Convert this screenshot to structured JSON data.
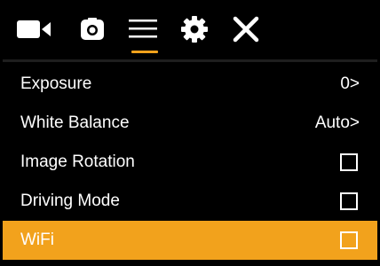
{
  "toolbar": {
    "icons": [
      {
        "name": "video-camera-icon"
      },
      {
        "name": "photo-camera-icon"
      },
      {
        "name": "menu-icon",
        "active": true
      },
      {
        "name": "gear-icon"
      },
      {
        "name": "close-icon"
      }
    ],
    "accent_color": "#f2a21c"
  },
  "menu": {
    "items": [
      {
        "label": "Exposure",
        "value": "0>",
        "type": "value"
      },
      {
        "label": "White Balance",
        "value": "Auto>",
        "type": "value"
      },
      {
        "label": "Image Rotation",
        "checked": false,
        "type": "checkbox"
      },
      {
        "label": "Driving Mode",
        "checked": false,
        "type": "checkbox"
      },
      {
        "label": "WiFi",
        "checked": false,
        "type": "checkbox",
        "selected": true
      }
    ]
  },
  "colors": {
    "background": "#000000",
    "text": "#ffffff",
    "highlight": "#f2a21c"
  }
}
